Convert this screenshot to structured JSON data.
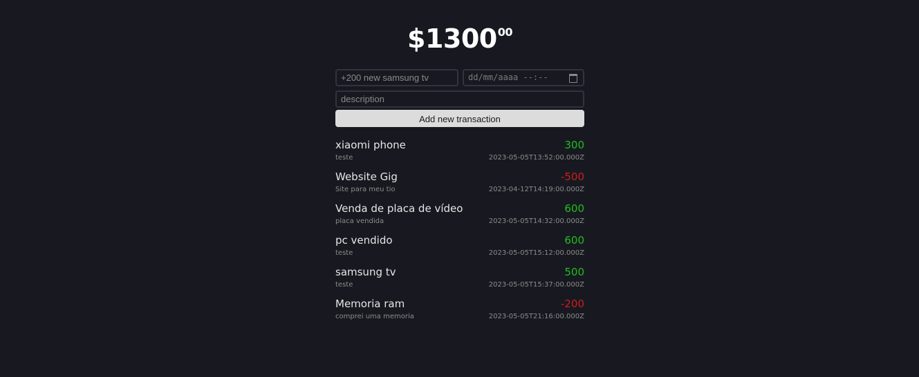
{
  "balance": {
    "dollars": "$1300",
    "cents": "00"
  },
  "form": {
    "name_placeholder": "+200 new samsung tv",
    "date_placeholder": "dd/mm/aaaa --:--",
    "description_placeholder": "description",
    "submit_label": "Add new transaction"
  },
  "transactions": [
    {
      "name": "xiaomi phone",
      "price": "300",
      "description": "teste",
      "datetime": "2023-05-05T13:52:00.000Z",
      "sign": "pos"
    },
    {
      "name": "Website Gig",
      "price": "-500",
      "description": "Site para meu tio",
      "datetime": "2023-04-12T14:19:00.000Z",
      "sign": "neg"
    },
    {
      "name": "Venda de placa de vídeo",
      "price": "600",
      "description": "placa vendida",
      "datetime": "2023-05-05T14:32:00.000Z",
      "sign": "pos"
    },
    {
      "name": "pc vendido",
      "price": "600",
      "description": "teste",
      "datetime": "2023-05-05T15:12:00.000Z",
      "sign": "pos"
    },
    {
      "name": "samsung tv",
      "price": "500",
      "description": "teste",
      "datetime": "2023-05-05T15:37:00.000Z",
      "sign": "pos"
    },
    {
      "name": "Memoria ram",
      "price": "-200",
      "description": "comprei uma memoria",
      "datetime": "2023-05-05T21:16:00.000Z",
      "sign": "neg"
    }
  ],
  "colors": {
    "background": "#181920",
    "positive": "#1fbf1f",
    "negative": "#d01c1c",
    "button": "#dcdcdc"
  }
}
